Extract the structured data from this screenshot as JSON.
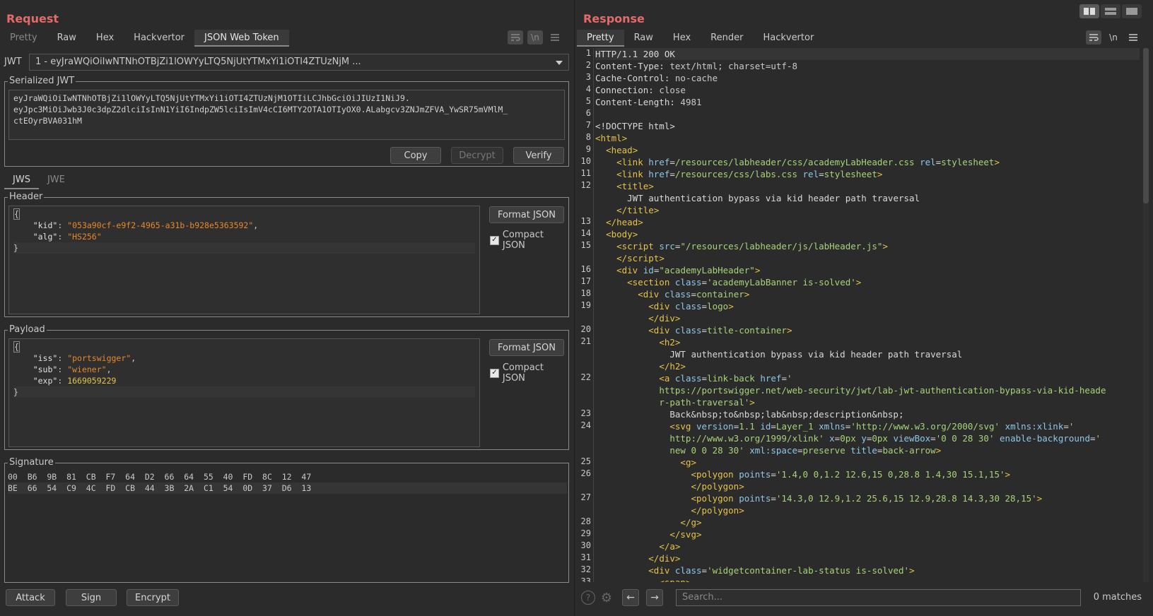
{
  "request": {
    "title": "Request",
    "tabs": [
      "Pretty",
      "Raw",
      "Hex",
      "Hackvertor",
      "JSON Web Token"
    ],
    "active_tab": "JSON Web Token",
    "jwt_label": "JWT",
    "jwt_selected": "1 - eyJraWQiOiIwNTNhOTBjZi1lOWYyLTQ5NjUtYTMxYi1iOTI4ZTUzNjM ...",
    "serialized": {
      "legend": "Serialized JWT",
      "lines": [
        "eyJraWQiOiIwNTNhOTBjZi1lOWYyLTQ5NjUtYTMxYi1iOTI4ZTUzNjM1OTIiLCJhbGciOiJIUzI1NiJ9.",
        "eyJpc3MiOiJwb3J0c3dpZ2dlciIsInN1YiI6IndpZW5lciIsImV4cCI6MTY2OTA1OTIyOX0.ALabgcv3ZNJmZFVA_YwSR75mVMlM_",
        "ctEOyrBVA031hM"
      ],
      "copy": "Copy",
      "decrypt": "Decrypt",
      "verify": "Verify"
    },
    "subtabs": [
      "JWS",
      "JWE"
    ],
    "header": {
      "legend": "Header",
      "format_button": "Format JSON",
      "compact_label": "Compact JSON",
      "open": "{",
      "close": "}",
      "rows": [
        {
          "key": "\"kid\"",
          "value": "\"053a90cf-e9f2-4965-a31b-b928e5363592\"",
          "trail": ","
        },
        {
          "key": "\"alg\"",
          "value": "\"HS256\"",
          "trail": ""
        }
      ]
    },
    "payload": {
      "legend": "Payload",
      "format_button": "Format JSON",
      "compact_label": "Compact JSON",
      "open": "{",
      "close": "}",
      "rows": [
        {
          "key": "\"iss\"",
          "value": "\"portswigger\"",
          "trail": ","
        },
        {
          "key": "\"sub\"",
          "value": "\"wiener\"",
          "trail": ","
        },
        {
          "key": "\"exp\"",
          "value": "1669059229",
          "trail": ""
        }
      ]
    },
    "signature": {
      "legend": "Signature",
      "hex1": "00  B6  9B  81  CB  F7  64  D2  66  64  55  40  FD  8C  12  47",
      "hex2": "BE  66  54  C9  4C  FD  CB  44  3B  2A  C1  54  0D  37  D6  13"
    },
    "bottom": {
      "attack": "Attack",
      "sign": "Sign",
      "encrypt": "Encrypt"
    }
  },
  "response": {
    "title": "Response",
    "tabs": [
      "Pretty",
      "Raw",
      "Hex",
      "Render",
      "Hackvertor"
    ],
    "active_tab": "Pretty",
    "line_numbers": [
      "1",
      "2",
      "3",
      "4",
      "5",
      "6",
      "7",
      "8",
      "9",
      "10",
      "11",
      "12",
      "13",
      "14",
      "15",
      "16",
      "17",
      "18",
      "19",
      "20",
      "21",
      "22",
      "23",
      "24",
      "25",
      "26",
      "27",
      "28",
      "29",
      "30",
      "31",
      "32",
      "33"
    ],
    "search_placeholder": "Search...",
    "matches": "0 matches"
  },
  "icons": {
    "wrap": "wrap-icon",
    "newline": "\\n",
    "menu": "menu-icon"
  }
}
